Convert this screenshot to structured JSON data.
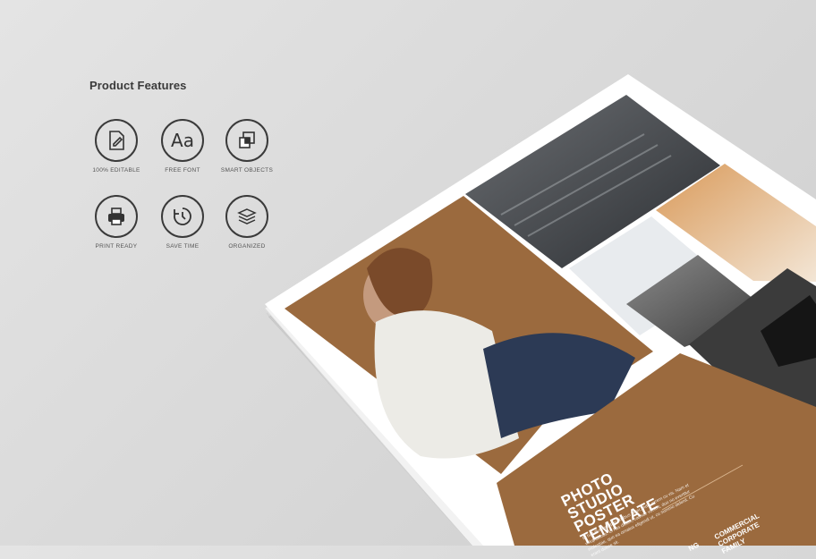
{
  "features": {
    "title": "Product Features",
    "items": [
      {
        "label": "100% EDITABLE",
        "icon": "edit-document-icon"
      },
      {
        "label": "FREE FONT",
        "icon": "font-aa-icon",
        "glyph": "Aa"
      },
      {
        "label": "SMART OBJECTS",
        "icon": "smart-objects-icon"
      },
      {
        "label": "PRINT READY",
        "icon": "printer-icon"
      },
      {
        "label": "SAVE TIME",
        "icon": "clock-icon"
      },
      {
        "label": "ORGANIZED",
        "icon": "layers-icon"
      }
    ]
  },
  "poster": {
    "title_lines": [
      "PHOTO",
      "STUDIO",
      "POSTER",
      "TEMPLATE"
    ],
    "body": "Ei hac illum vituperatoribus facer, vide, errem cu vis. Nam et voluptatibus. Ei has dicunt, causae vocent, duo no evertitur molestiae, quo ea ornatus eligendi ut, cu summo delenit. Cu erant dolore sit.",
    "subtitle_lines": [
      "COMMERCIAL",
      "CORPORATE",
      "FAMILY"
    ],
    "subtitle_left": "NG",
    "colors": {
      "brown": "#9b6a3e",
      "paper": "#ffffff"
    }
  }
}
